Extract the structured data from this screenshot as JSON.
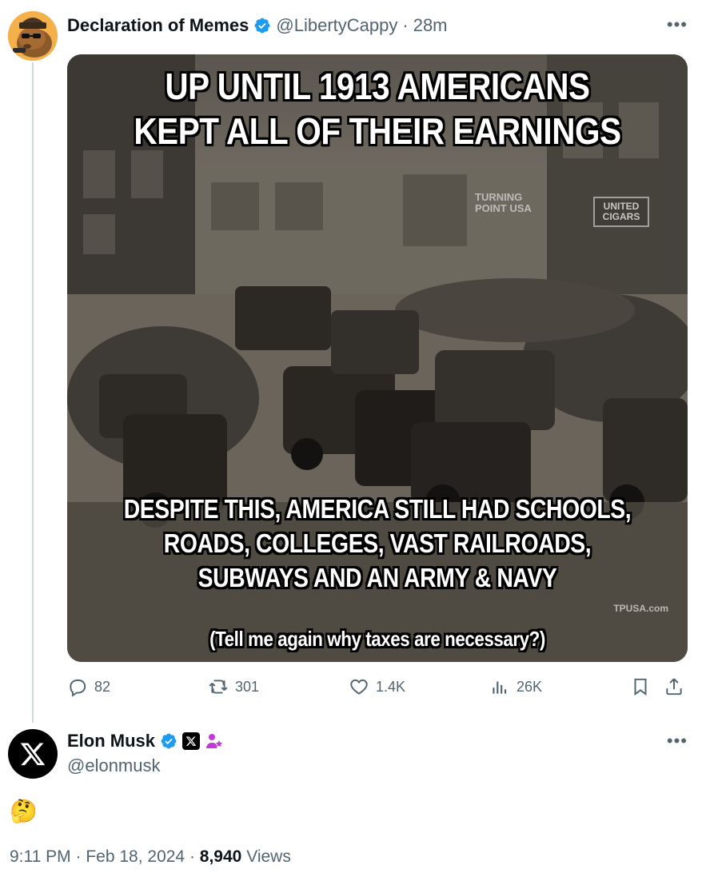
{
  "parent_tweet": {
    "author_name": "Declaration of Memes",
    "handle": "@LibertyCappy",
    "separator": "·",
    "time_ago": "28m",
    "more_label": "•••",
    "meme": {
      "top_text_line1": "UP UNTIL 1913 AMERICANS",
      "top_text_line2": "KEPT ALL OF THEIR EARNINGS",
      "bottom_text_line1": "DESPITE THIS, AMERICA STILL HAD SCHOOLS,",
      "bottom_text_line2": "ROADS, COLLEGES, VAST RAILROADS,",
      "bottom_text_line3": "SUBWAYS AND AN ARMY & NAVY",
      "bottom_sub": "(Tell me again why taxes are necessary?)",
      "watermark": "TPUSA.com",
      "logo_line1": "TURNING",
      "logo_line2": "POINT USA",
      "sign_line1": "UNITED",
      "sign_line2": "CIGARS"
    },
    "actions": {
      "replies": "82",
      "reposts": "301",
      "likes": "1.4K",
      "views": "26K"
    }
  },
  "reply_tweet": {
    "author_name": "Elon Musk",
    "handle": "@elonmusk",
    "more_label": "•••",
    "body": "🤔",
    "time": "9:11 PM",
    "date": "Feb 18, 2024",
    "separator": "·",
    "views_count": "8,940",
    "views_label": "Views"
  },
  "colors": {
    "verified_blue": "#1d9bf0",
    "muted": "#536471",
    "thread_line": "#cfd9de",
    "text": "#0f1419",
    "badge_purple": "#c13ad8"
  },
  "icons": [
    "verified-icon",
    "reply-icon",
    "repost-icon",
    "like-icon",
    "views-icon",
    "bookmark-icon",
    "share-icon",
    "x-logo-icon",
    "affiliate-x-icon",
    "person-star-icon"
  ]
}
